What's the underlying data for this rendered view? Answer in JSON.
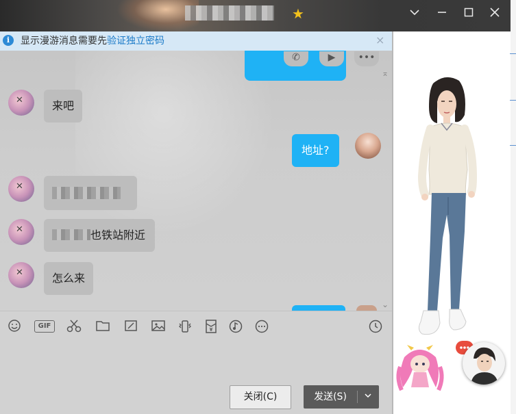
{
  "window": {
    "star_icon": "star-icon",
    "controls": {
      "dropdown": "chevron-down-icon",
      "minimize": "minimize-icon",
      "maximize": "maximize-icon",
      "close": "close-icon"
    }
  },
  "notice": {
    "text": "显示漫游消息需要先",
    "link": "验证独立密码",
    "close": "×"
  },
  "messages": [
    {
      "side": "left",
      "text": "来吧"
    },
    {
      "side": "right",
      "text": "地址?"
    },
    {
      "side": "left",
      "text": "",
      "blurred": true
    },
    {
      "side": "left",
      "text": "也铁站附近",
      "blurred_prefix": true
    },
    {
      "side": "left",
      "text": "怎么来"
    }
  ],
  "toolbar": {
    "gif_label": "GIF",
    "icons": [
      "smile-icon",
      "gif-icon",
      "scissors-icon",
      "folder-icon",
      "image-edit-icon",
      "image-icon",
      "shake-icon",
      "red-packet-icon",
      "music-icon",
      "more-icon",
      "history-clock-icon"
    ]
  },
  "actions": {
    "close_label": "关闭(C)",
    "send_label": "发送(S)"
  },
  "colors": {
    "bubble_right": "#1fb2f5",
    "notice_bg": "#d6e8f6",
    "notice_link": "#1a7ac8"
  }
}
